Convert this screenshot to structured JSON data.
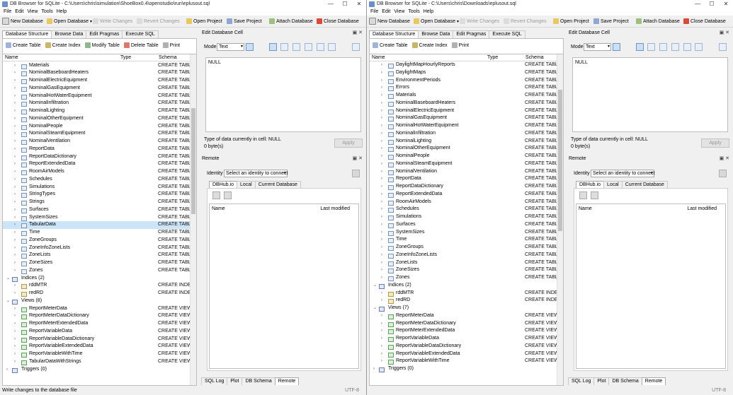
{
  "common": {
    "menu": [
      "File",
      "Edit",
      "View",
      "Tools",
      "Help"
    ],
    "toolbar": {
      "new_db": "New Database",
      "open_db": "Open Database",
      "write": "Write Changes",
      "revert": "Revert Changes",
      "open_project": "Open Project",
      "save_project": "Save Project",
      "attach": "Attach Database",
      "close_db": "Close Database"
    },
    "tabs": [
      "Database Structure",
      "Browse Data",
      "Edit Pragmas",
      "Execute SQL"
    ],
    "col_name": "Name",
    "col_type": "Type",
    "col_schema": "Schema",
    "edit_cell_title": "Edit Database Cell",
    "mode_label": "Mode:",
    "mode_value": "Text",
    "cell_value": "NULL",
    "cell_type": "Type of data currently in cell: NULL",
    "cell_size": "0 byte(s)",
    "apply": "Apply",
    "remote_title": "Remote",
    "identity_label": "Identity",
    "identity_value": "Select an identity to connect",
    "remote_tabs": [
      "DBHub.io",
      "Local",
      "Current Database"
    ],
    "remote_col_name": "Name",
    "remote_col_modified": "Last modified",
    "bottom_tabs": [
      "SQL Log",
      "Plot",
      "DB Schema",
      "Remote"
    ],
    "dock_buttons": "▣ ✕",
    "create_table": "CREATE TABLE",
    "create_index": "CREATE INDEX",
    "create_view": "CREATE VIEW",
    "encoding": "UTF-8",
    "colors": {
      "selection": "#cce4f7",
      "panel_bg": "#ffffff",
      "chrome": "#f0f0f0"
    }
  },
  "left": {
    "title": "DB Browser for SQLite - C:\\Users\\chris\\simulation\\ShoeBox0.4\\openstudio\\run\\eplusout.sql",
    "subtoolbar": [
      "Create Table",
      "Create Index",
      "Modify Table",
      "Delete Table",
      "Print"
    ],
    "rows": [
      {
        "label": "Materials",
        "kind": "table"
      },
      {
        "label": "NominalBaseboardHeaters",
        "kind": "table"
      },
      {
        "label": "NominalElectricEquipment",
        "kind": "table"
      },
      {
        "label": "NominalGasEquipment",
        "kind": "table"
      },
      {
        "label": "NominalHotWaterEquipment",
        "kind": "table"
      },
      {
        "label": "NominalInfiltration",
        "kind": "table"
      },
      {
        "label": "NominalLighting",
        "kind": "table"
      },
      {
        "label": "NominalOtherEquipment",
        "kind": "table"
      },
      {
        "label": "NominalPeople",
        "kind": "table"
      },
      {
        "label": "NominalSteamEquipment",
        "kind": "table"
      },
      {
        "label": "NominalVentilation",
        "kind": "table"
      },
      {
        "label": "ReportData",
        "kind": "table"
      },
      {
        "label": "ReportDataDictionary",
        "kind": "table"
      },
      {
        "label": "ReportExtendedData",
        "kind": "table"
      },
      {
        "label": "RoomAirModels",
        "kind": "table"
      },
      {
        "label": "Schedules",
        "kind": "table"
      },
      {
        "label": "Simulations",
        "kind": "table"
      },
      {
        "label": "StringTypes",
        "kind": "table"
      },
      {
        "label": "Strings",
        "kind": "table"
      },
      {
        "label": "Surfaces",
        "kind": "table"
      },
      {
        "label": "SystemSizes",
        "kind": "table"
      },
      {
        "label": "TabularData",
        "kind": "table",
        "selected": true
      },
      {
        "label": "Time",
        "kind": "table"
      },
      {
        "label": "ZoneGroups",
        "kind": "table"
      },
      {
        "label": "ZoneInfoZoneLists",
        "kind": "table"
      },
      {
        "label": "ZoneLists",
        "kind": "table"
      },
      {
        "label": "ZoneSizes",
        "kind": "table"
      },
      {
        "label": "Zones",
        "kind": "table"
      },
      {
        "label": "Indices (2)",
        "kind": "group"
      },
      {
        "label": "rddMTR",
        "kind": "index"
      },
      {
        "label": "redRD",
        "kind": "index"
      },
      {
        "label": "Views (8)",
        "kind": "group"
      },
      {
        "label": "ReportMeterData",
        "kind": "view"
      },
      {
        "label": "ReportMeterDataDictionary",
        "kind": "view"
      },
      {
        "label": "ReportMeterExtendedData",
        "kind": "view"
      },
      {
        "label": "ReportVariableData",
        "kind": "view"
      },
      {
        "label": "ReportVariableDataDictionary",
        "kind": "view"
      },
      {
        "label": "ReportVariableExtendedData",
        "kind": "view"
      },
      {
        "label": "ReportVariableWithTime",
        "kind": "view"
      },
      {
        "label": "TabularDataWithStrings",
        "kind": "view"
      },
      {
        "label": "Triggers (0)",
        "kind": "group"
      }
    ],
    "status": "Write changes to the database file"
  },
  "right": {
    "title": "DB Browser for SQLite - C:\\Users\\chris\\Downloads\\eplusout.sql",
    "subtoolbar": [
      "Create Table",
      "Create Index",
      "Print"
    ],
    "rows": [
      {
        "label": "DaylightMapHourlyReports",
        "kind": "table"
      },
      {
        "label": "DaylightMaps",
        "kind": "table"
      },
      {
        "label": "EnvironmentPeriods",
        "kind": "table"
      },
      {
        "label": "Errors",
        "kind": "table"
      },
      {
        "label": "Materials",
        "kind": "table"
      },
      {
        "label": "NominalBaseboardHeaters",
        "kind": "table"
      },
      {
        "label": "NominalElectricEquipment",
        "kind": "table"
      },
      {
        "label": "NominalGasEquipment",
        "kind": "table"
      },
      {
        "label": "NominalHotWaterEquipment",
        "kind": "table"
      },
      {
        "label": "NominalInfiltration",
        "kind": "table"
      },
      {
        "label": "NominalLighting",
        "kind": "table"
      },
      {
        "label": "NominalOtherEquipment",
        "kind": "table"
      },
      {
        "label": "NominalPeople",
        "kind": "table"
      },
      {
        "label": "NominalSteamEquipment",
        "kind": "table"
      },
      {
        "label": "NominalVentilation",
        "kind": "table"
      },
      {
        "label": "ReportData",
        "kind": "table"
      },
      {
        "label": "ReportDataDictionary",
        "kind": "table"
      },
      {
        "label": "ReportExtendedData",
        "kind": "table"
      },
      {
        "label": "RoomAirModels",
        "kind": "table"
      },
      {
        "label": "Schedules",
        "kind": "table"
      },
      {
        "label": "Simulations",
        "kind": "table"
      },
      {
        "label": "Surfaces",
        "kind": "table"
      },
      {
        "label": "SystemSizes",
        "kind": "table"
      },
      {
        "label": "Time",
        "kind": "table"
      },
      {
        "label": "ZoneGroups",
        "kind": "table"
      },
      {
        "label": "ZoneInfoZoneLists",
        "kind": "table"
      },
      {
        "label": "ZoneLists",
        "kind": "table"
      },
      {
        "label": "ZoneSizes",
        "kind": "table"
      },
      {
        "label": "Zones",
        "kind": "table"
      },
      {
        "label": "Indices (2)",
        "kind": "group"
      },
      {
        "label": "rddMTR",
        "kind": "index"
      },
      {
        "label": "redRD",
        "kind": "index"
      },
      {
        "label": "Views (7)",
        "kind": "group"
      },
      {
        "label": "ReportMeterData",
        "kind": "view"
      },
      {
        "label": "ReportMeterDataDictionary",
        "kind": "view"
      },
      {
        "label": "ReportMeterExtendedData",
        "kind": "view"
      },
      {
        "label": "ReportVariableData",
        "kind": "view"
      },
      {
        "label": "ReportVariableDataDictionary",
        "kind": "view"
      },
      {
        "label": "ReportVariableExtendedData",
        "kind": "view"
      },
      {
        "label": "ReportVariableWithTime",
        "kind": "view"
      },
      {
        "label": "Triggers (0)",
        "kind": "group"
      }
    ],
    "status": ""
  }
}
